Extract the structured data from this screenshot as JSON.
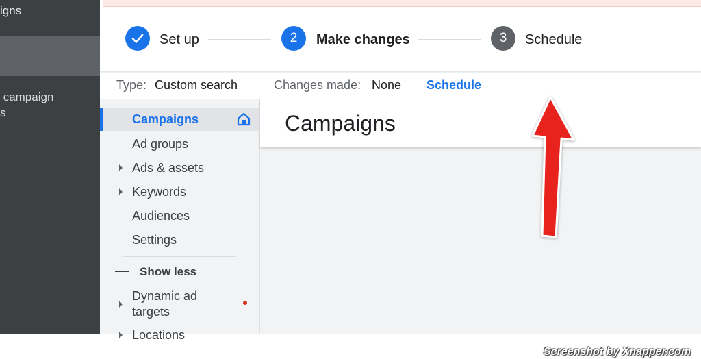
{
  "sidebar": {
    "item_top": "igns",
    "item_bottom": " campaign\ns"
  },
  "stepper": {
    "steps": [
      {
        "number": "",
        "label": "Set up",
        "status": "done"
      },
      {
        "number": "2",
        "label": "Make changes",
        "status": "current"
      },
      {
        "number": "3",
        "label": "Schedule",
        "status": "upcoming"
      }
    ]
  },
  "info": {
    "type_label": "Type:",
    "type_value": "Custom search",
    "changes_label": "Changes made:",
    "changes_value": "None",
    "schedule_link": "Schedule"
  },
  "nav": {
    "items": [
      {
        "label": "Campaigns",
        "active": true
      },
      {
        "label": "Ad groups"
      },
      {
        "label": "Ads & assets",
        "expandable": true
      },
      {
        "label": "Keywords",
        "expandable": true
      },
      {
        "label": "Audiences"
      },
      {
        "label": "Settings"
      }
    ],
    "show_less": "Show less",
    "dynamic_targets": "Dynamic ad targets",
    "locations": "Locations"
  },
  "content": {
    "title": "Campaigns"
  },
  "watermark": "Screenshot by Xnapper.com",
  "colors": {
    "accent": "#1a73e8",
    "sidebar_dark": "#3c4043",
    "arrow": "#e8201a"
  }
}
